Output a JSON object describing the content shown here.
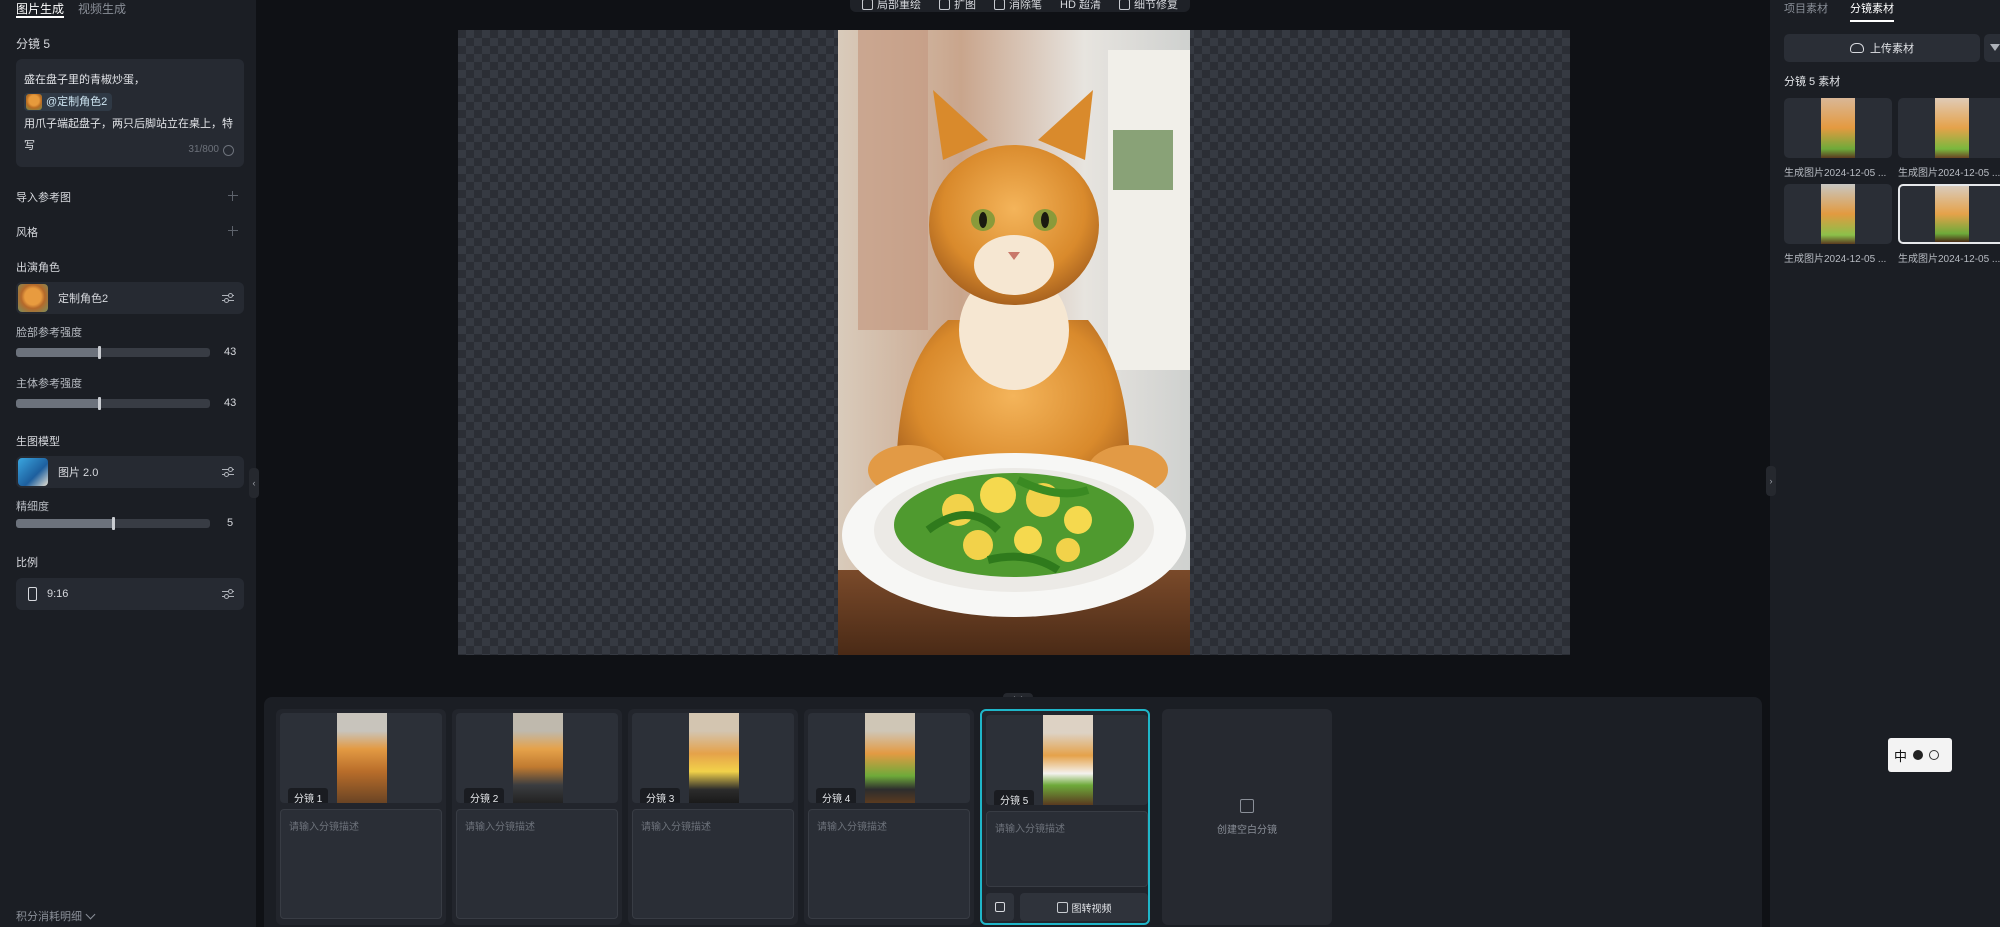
{
  "left_panel": {
    "tabs": [
      "图片生成",
      "视频生成"
    ],
    "shot_title": "分镜 5",
    "prompt": {
      "line1": "盛在盘子里的青椒炒蛋，",
      "mention": "@定制角色2",
      "line2": "用爪子端起盘子，两只后脚站立在桌上，特写",
      "counter": "31/800"
    },
    "import_ref_label": "导入参考图",
    "style_label": "风格",
    "cast_label": "出演角色",
    "character_name": "定制角色2",
    "face_strength": {
      "label": "脸部参考强度",
      "value": 43,
      "max": 100
    },
    "subject_strength": {
      "label": "主体参考强度",
      "value": 43,
      "max": 100
    },
    "model_label": "生图模型",
    "model_name": "图片 2.0",
    "fineness": {
      "label": "精细度",
      "value": 5,
      "max": 10
    },
    "ratio_label": "比例",
    "ratio_value": "9:16",
    "footer": "积分消耗明细"
  },
  "toolbar": {
    "tools": [
      {
        "label": "局部重绘",
        "icon": "brush-icon"
      },
      {
        "label": "扩图",
        "icon": "expand-icon"
      },
      {
        "label": "消除笔",
        "icon": "eraser-icon"
      },
      {
        "label": "HD 超清",
        "icon": "hd-icon"
      },
      {
        "label": "细节修复",
        "icon": "wand-icon"
      }
    ]
  },
  "right_panel": {
    "tabs": [
      "项目素材",
      "分镜素材"
    ],
    "upload_label": "上传素材",
    "section_title": "分镜 5 素材",
    "assets": [
      {
        "label": "生成图片2024-12-05 ..."
      },
      {
        "label": "生成图片2024-12-05 ..."
      },
      {
        "label": "生成图片2024-12-05 ..."
      },
      {
        "label": "生成图片2024-12-05 ..."
      }
    ]
  },
  "storyboard": {
    "shots": [
      {
        "label": "分镜 1",
        "placeholder": "请输入分镜描述"
      },
      {
        "label": "分镜 2",
        "placeholder": "请输入分镜描述"
      },
      {
        "label": "分镜 3",
        "placeholder": "请输入分镜描述"
      },
      {
        "label": "分镜 4",
        "placeholder": "请输入分镜描述"
      },
      {
        "label": "分镜 5",
        "placeholder": "请输入分镜描述"
      }
    ],
    "to_video_label": "图转视频",
    "new_shot_label": "创建空白分镜"
  },
  "ime": {
    "label": "中"
  },
  "colors": {
    "accent": "#1fb6c9",
    "background": "#0f1115",
    "panel": "#1b1e24"
  }
}
